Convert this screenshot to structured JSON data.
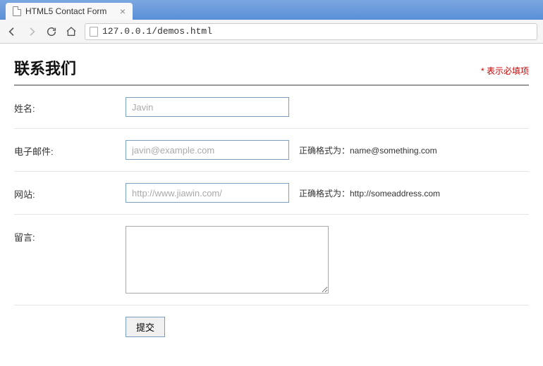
{
  "browser": {
    "tab_title": "HTML5 Contact Form",
    "url": "127.0.0.1/demos.html"
  },
  "page": {
    "title": "联系我们",
    "required_note": "表示必填项"
  },
  "form": {
    "name": {
      "label": "姓名:",
      "placeholder": "Javin",
      "value": ""
    },
    "email": {
      "label": "电子邮件:",
      "placeholder": "javin@example.com",
      "value": "",
      "hint": "正确格式为：name@something.com"
    },
    "website": {
      "label": "网站:",
      "placeholder": "http://www.jiawin.com/",
      "value": "",
      "hint": "正确格式为：http://someaddress.com"
    },
    "message": {
      "label": "留言:",
      "value": ""
    },
    "submit_label": "提交"
  }
}
